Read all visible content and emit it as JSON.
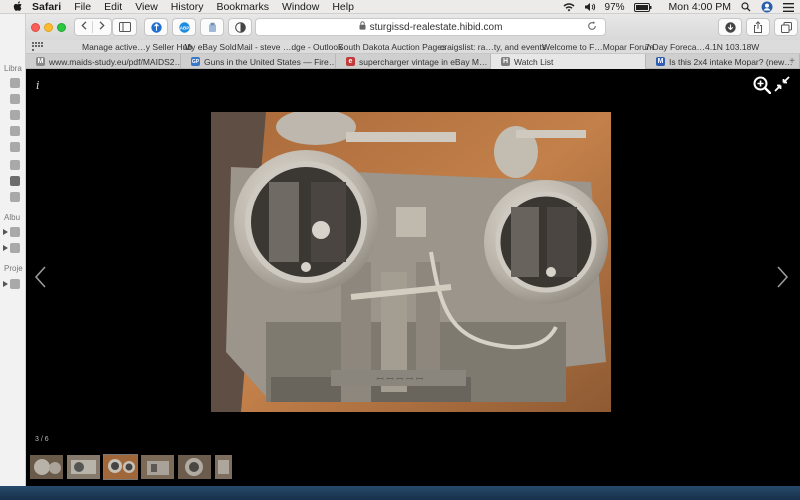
{
  "menubar": {
    "app": "Safari",
    "items": [
      "File",
      "Edit",
      "View",
      "History",
      "Bookmarks",
      "Window",
      "Help"
    ],
    "battery": "97%",
    "clock": "Mon 4:00 PM"
  },
  "behind_app": {
    "labels": [
      "Libra",
      "Albu",
      "Proje"
    ]
  },
  "toolbar": {
    "url": "sturgissd-realestate.hibid.com"
  },
  "bookmarks": [
    "Manage active…y Seller Hub",
    "My eBay Sold",
    "Mail - steve …dge - Outlook",
    "South Dakota Auction Pages",
    "craigslist: ra…ty, and events",
    "Welcome to F…Mopar Forum",
    "7-Day Foreca…4.1N 103.18W"
  ],
  "tabs": [
    {
      "label": "www.maids-study.eu/pdf/MAIDS2…",
      "favicon": "M",
      "color": "#8a8a8a"
    },
    {
      "label": "Guns in the United States — Fire…",
      "favicon": "GP",
      "color": "#3a78c9"
    },
    {
      "label": "supercharger vintage in eBay M…",
      "favicon": "e",
      "color": "#c23b3b"
    },
    {
      "label": "Watch List",
      "favicon": "H",
      "color": "#7f7f7f"
    },
    {
      "label": "Is this 2x4 intake Mopar? (new…",
      "favicon": "M",
      "color": "#2f5fb3"
    }
  ],
  "lightbox": {
    "info_label": "i",
    "counter": "3 / 6",
    "thumb_count": 6,
    "selected_index": 2
  },
  "colors": {
    "lightbox_bg": "#000000",
    "desk_wood": "#b0703c"
  }
}
